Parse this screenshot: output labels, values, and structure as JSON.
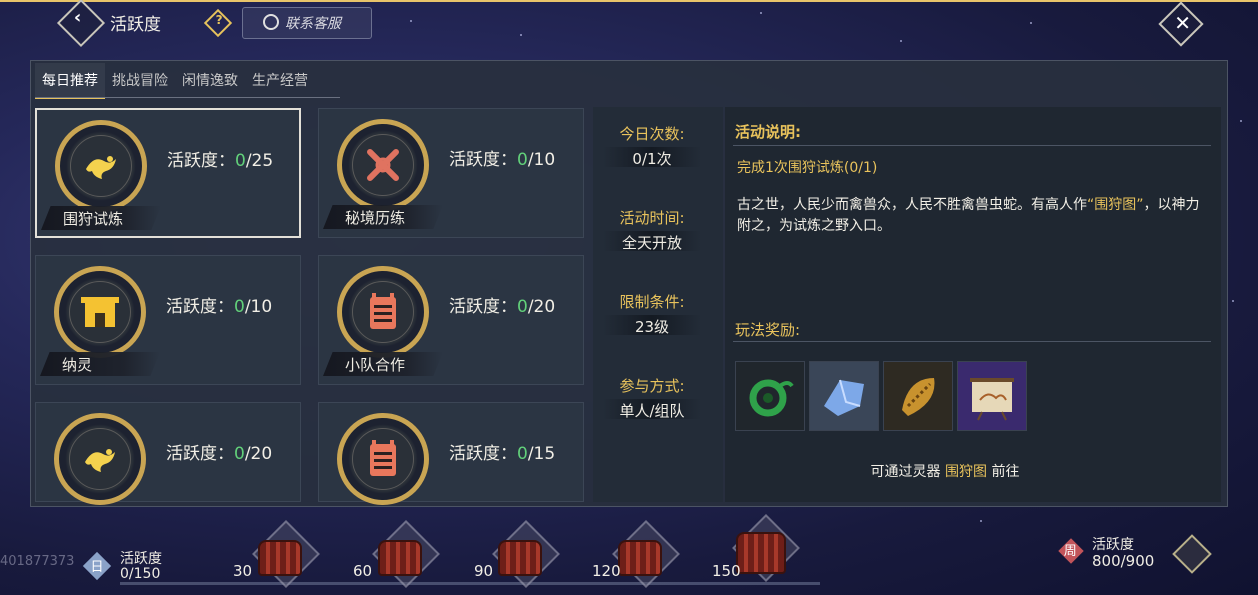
{
  "header": {
    "title": "活跃度",
    "help_icon_label": "?",
    "customer_service_label": "联系客服"
  },
  "tabs": [
    {
      "label": "每日推荐",
      "active": true
    },
    {
      "label": "挑战冒险",
      "active": false
    },
    {
      "label": "闲情逸致",
      "active": false
    },
    {
      "label": "生产经营",
      "active": false
    }
  ],
  "cards": [
    {
      "name": "围狩试炼",
      "activity_label": "活跃度：",
      "current": "0",
      "max": "/25",
      "icon": "dragon-icon",
      "selected": true
    },
    {
      "name": "秘境历练",
      "activity_label": "活跃度：",
      "current": "0",
      "max": "/10",
      "icon": "crossed-swords-icon",
      "selected": false
    },
    {
      "name": "纳灵",
      "activity_label": "活跃度：",
      "current": "0",
      "max": "/10",
      "icon": "gate-icon",
      "selected": false
    },
    {
      "name": "小队合作",
      "activity_label": "活跃度：",
      "current": "0",
      "max": "/20",
      "icon": "scroll-icon",
      "selected": false
    },
    {
      "name": "",
      "activity_label": "活跃度：",
      "current": "0",
      "max": "/20",
      "icon": "dragon-icon",
      "selected": false
    },
    {
      "name": "",
      "activity_label": "活跃度：",
      "current": "0",
      "max": "/15",
      "icon": "scroll-icon",
      "selected": false
    }
  ],
  "info": {
    "times_label": "今日次数:",
    "times_value": "0/1次",
    "time_label": "活动时间:",
    "time_value": "全天开放",
    "limit_label": "限制条件:",
    "limit_value": "23级",
    "mode_label": "参与方式:",
    "mode_value": "单人/组队"
  },
  "description": {
    "title": "活动说明:",
    "goal": "完成1次围狩试炼(0/1)",
    "lore_part1": "古之世，人民少而禽兽众，人民不胜禽兽虫蛇。有高人作",
    "lore_highlight": "“围狩图”",
    "lore_part2": "，以神力附之，为试炼之野入口。",
    "rewards_title": "玩法奖励:",
    "rewards": [
      {
        "icon": "jade-pendant-icon"
      },
      {
        "icon": "crystal-icon"
      },
      {
        "icon": "golden-fragment-icon"
      },
      {
        "icon": "painting-scroll-icon"
      }
    ],
    "via_prefix": "可通过灵器",
    "via_item": "围狩图",
    "via_suffix": "前往"
  },
  "bottom": {
    "uid": "401877373",
    "daily_badge": "日",
    "daily_label": "活跃度",
    "daily_value": "0/150",
    "milestones": [
      "30",
      "60",
      "90",
      "120",
      "150"
    ],
    "weekly_badge": "周",
    "weekly_label": "活跃度",
    "weekly_value": "800/900"
  },
  "colors": {
    "accent_gold": "#e9c35c",
    "progress_green": "#62d07a",
    "panel_bg": "#28303e"
  }
}
